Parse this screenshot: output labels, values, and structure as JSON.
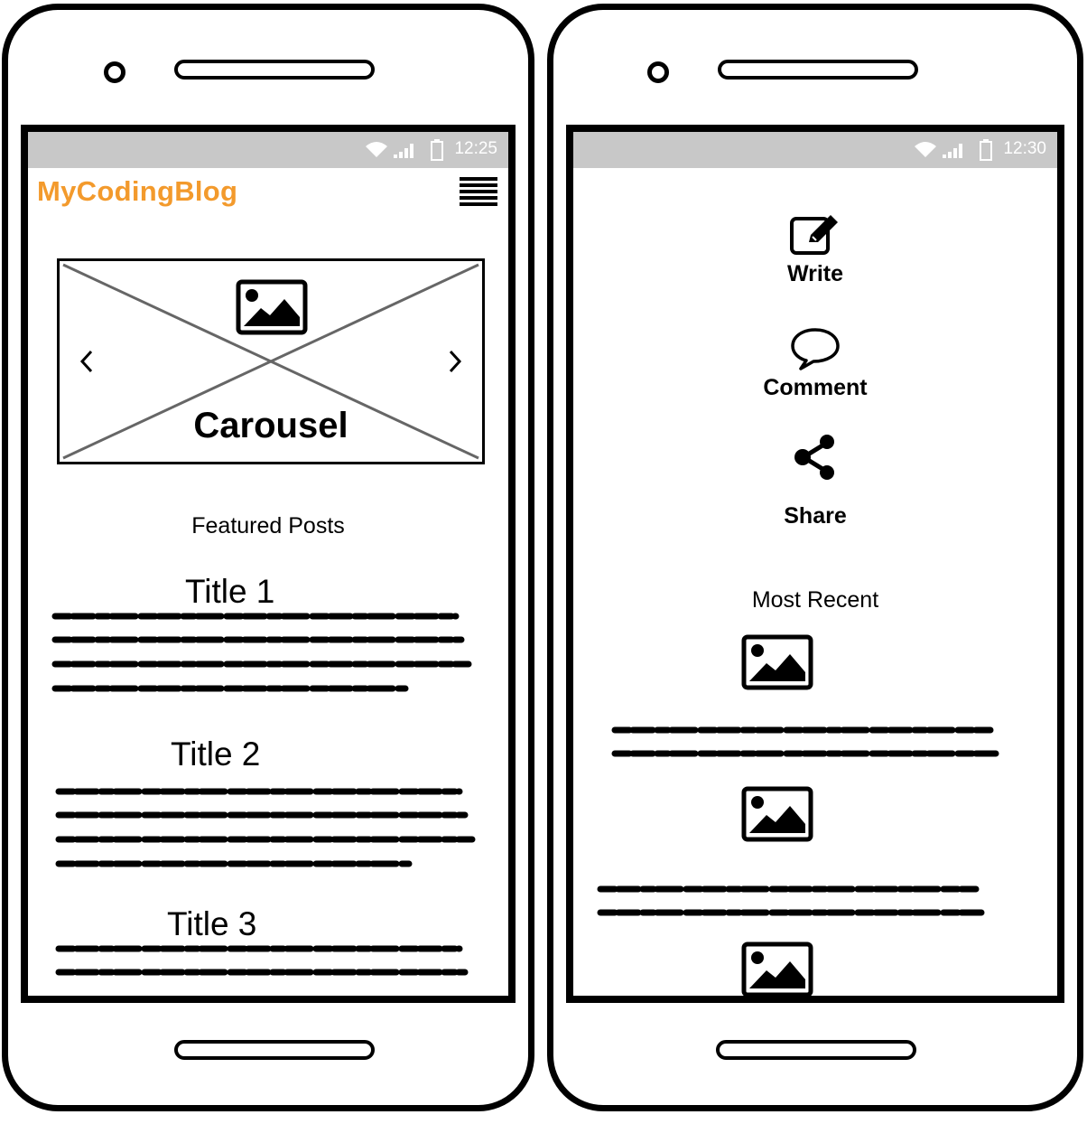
{
  "left_phone": {
    "status": {
      "time": "12:25"
    },
    "header": {
      "logo": "MyCodingBlog",
      "menu_icon": "hamburger-menu-icon"
    },
    "carousel": {
      "label": "Carousel",
      "prev_icon": "chevron-left-icon",
      "next_icon": "chevron-right-icon",
      "image_icon": "image-icon"
    },
    "featured": {
      "heading": "Featured Posts"
    },
    "posts": [
      {
        "title": "Title 1"
      },
      {
        "title": "Title 2"
      },
      {
        "title": "Title 3"
      }
    ]
  },
  "right_phone": {
    "status": {
      "time": "12:30"
    },
    "actions": [
      {
        "label": "Write",
        "icon": "edit-icon"
      },
      {
        "label": "Comment",
        "icon": "speech-bubble-icon"
      },
      {
        "label": "Share",
        "icon": "share-icon"
      }
    ],
    "recent": {
      "heading": "Most Recent",
      "item_icon": "image-icon"
    }
  },
  "colors": {
    "brand": "#f39a2c",
    "statusbar": "#c8c8c8",
    "ink": "#000000"
  }
}
